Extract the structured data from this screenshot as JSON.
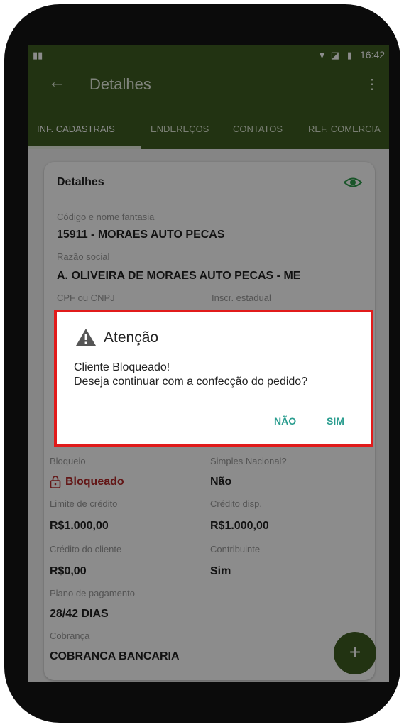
{
  "status_bar": {
    "time": "16:42"
  },
  "app_bar": {
    "title": "Detalhes"
  },
  "tabs": [
    {
      "label": "INF. CADASTRAIS"
    },
    {
      "label": "ENDEREÇOS"
    },
    {
      "label": "CONTATOS"
    },
    {
      "label": "REF. COMERCIA"
    }
  ],
  "card": {
    "header": "Detalhes",
    "fields": {
      "codigo_label": "Código e nome fantasia",
      "codigo_value": "15911 - MORAES AUTO PECAS",
      "razao_label": "Razão social",
      "razao_value": "A. OLIVEIRA DE MORAES AUTO PECAS - ME",
      "cpf_label": "CPF ou CNPJ",
      "inscr_label": "Inscr. estadual",
      "bloqueio_label": "Bloqueio",
      "bloqueio_value": "Bloqueado",
      "simples_label": "Simples Nacional?",
      "simples_value": "Não",
      "limite_label": "Limite de crédito",
      "limite_value": "R$1.000,00",
      "credito_disp_label": "Crédito disp.",
      "credito_disp_value": "R$1.000,00",
      "credito_cliente_label": "Crédito do cliente",
      "credito_cliente_value": "R$0,00",
      "contribuinte_label": "Contribuinte",
      "contribuinte_value": "Sim",
      "plano_label": "Plano de pagamento",
      "plano_value": "28/42 DIAS",
      "cobranca_label": "Cobrança",
      "cobranca_value": "COBRANCA BANCARIA"
    }
  },
  "fab": {
    "label": "+"
  },
  "dialog": {
    "title": "Atenção",
    "message_line1": "Cliente Bloqueado!",
    "message_line2": "Deseja continuar com a confecção do pedido?",
    "btn_no": "NÃO",
    "btn_yes": "SIM"
  },
  "colors": {
    "primary": "#3e5e22",
    "accent": "#2a9d8f",
    "danger": "#b52a2a",
    "highlight_border": "#e11b1b"
  }
}
